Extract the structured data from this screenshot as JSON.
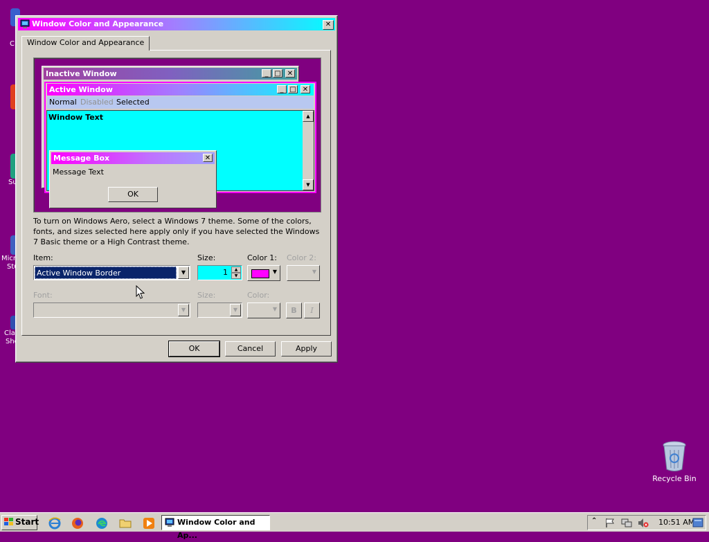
{
  "dialog": {
    "title": "Window Color and Appearance",
    "tab_label": "Window Color and Appearance",
    "description": "To turn on Windows Aero, select a Windows 7 theme.  Some of the colors, fonts, and sizes selected here apply only if you have selected the Windows 7 Basic theme or a High Contrast theme.",
    "ok_label": "OK",
    "cancel_label": "Cancel",
    "apply_label": "Apply"
  },
  "preview": {
    "inactive_title": "Inactive Window",
    "active_title": "Active Window",
    "menu_normal": "Normal",
    "menu_disabled": "Disabled",
    "menu_selected": "Selected",
    "window_text": "Window Text",
    "msgbox_title": "Message Box",
    "msgbox_text": "Message Text",
    "msgbox_ok": "OK"
  },
  "controls": {
    "item_label": "Item:",
    "item_value": "Active Window Border",
    "size_label": "Size:",
    "size_value": "1",
    "color1_label": "Color 1:",
    "color2_label": "Color 2:",
    "font_label": "Font:",
    "font_size_label": "Size:",
    "font_color_label": "Color:",
    "bold_label": "B",
    "italic_label": "I"
  },
  "colors": {
    "desktop": "#800080",
    "color1_swatch": "#ff00ff",
    "size_field_bg": "#00ffff",
    "item_highlight": "#0a246a"
  },
  "desktop": {
    "recycle_bin_label": "Recycle Bin",
    "left_icon_labels": [
      "C",
      "Su",
      "Micro",
      "Stu",
      "Cla",
      "She"
    ]
  },
  "taskbar": {
    "start_label": "Start",
    "task_label": "Window Color and Ap...",
    "clock": "10:51 AM"
  }
}
